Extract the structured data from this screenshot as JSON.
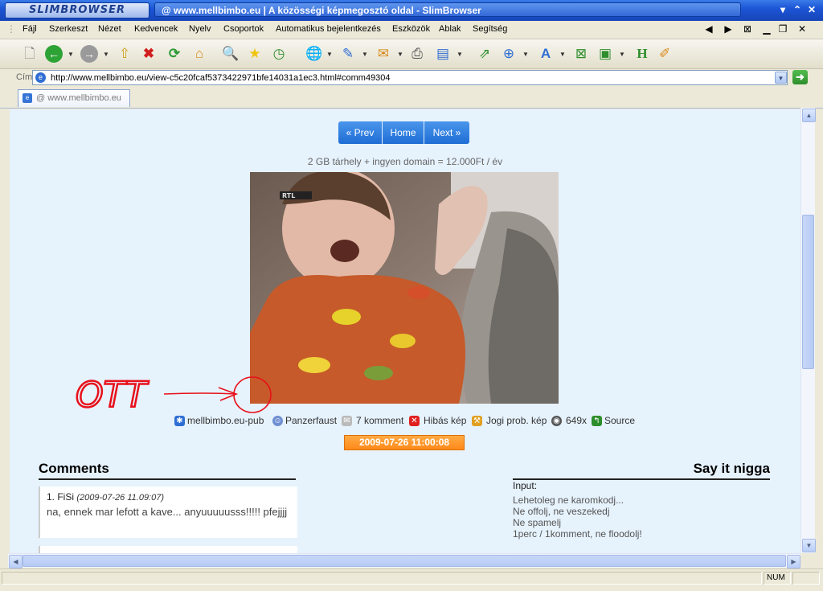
{
  "app": {
    "logo_text": "SLIMBROWSER",
    "window_title": "@ www.mellbimbo.eu | A közösségi képmegosztó oldal - SlimBrowser"
  },
  "menu": [
    "Fájl",
    "Szerkeszt",
    "Nézet",
    "Kedvencek",
    "Nyelv",
    "Csoportok",
    "Automatikus bejelentkezés",
    "Eszközök",
    "Ablak",
    "Segítség"
  ],
  "address": {
    "label": "Cím",
    "url": "http://www.mellbimbo.eu/view-c5c20fcaf5373422971bfe14031a1ec3.html#comm49304"
  },
  "tab": {
    "title": "@ www.mellbimbo.eu"
  },
  "page": {
    "pager": {
      "prev": "« Prev",
      "home": "Home",
      "next": "Next »"
    },
    "ad_text": "2 GB tárhely + ingyen domain = 12.000Ft / év",
    "photo_logo": "RTL",
    "annotation_text": "OTT",
    "meta": {
      "uploader_group": "mellbimbo.eu-pub",
      "user": "Panzerfaust",
      "comments": "7 komment",
      "error": "Hibás kép",
      "rights": "Jogi prob. kép",
      "views": "649x",
      "source": "Source"
    },
    "date": "2009-07-26 11:00:08",
    "comments_heading": "Comments",
    "comment1": {
      "index_user": "1. FiSi",
      "date": "(2009-07-26 11.09:07)",
      "text": "na, ennek mar lefott a kave... anyuuuuusss!!!!! pfejjjj"
    },
    "form_heading": "Say it nigga",
    "input_label": "Input:",
    "rules": [
      "Lehetoleg ne karomkodj...",
      "Ne offolj, ne veszekedj",
      "Ne spamelj",
      "1perc / 1komment, ne floodolj!"
    ]
  },
  "status": {
    "num": "NUM"
  },
  "colors": {
    "accent": "#1f6dd5",
    "date_badge": "#ff8a1a",
    "annotation": "#e8101a"
  }
}
